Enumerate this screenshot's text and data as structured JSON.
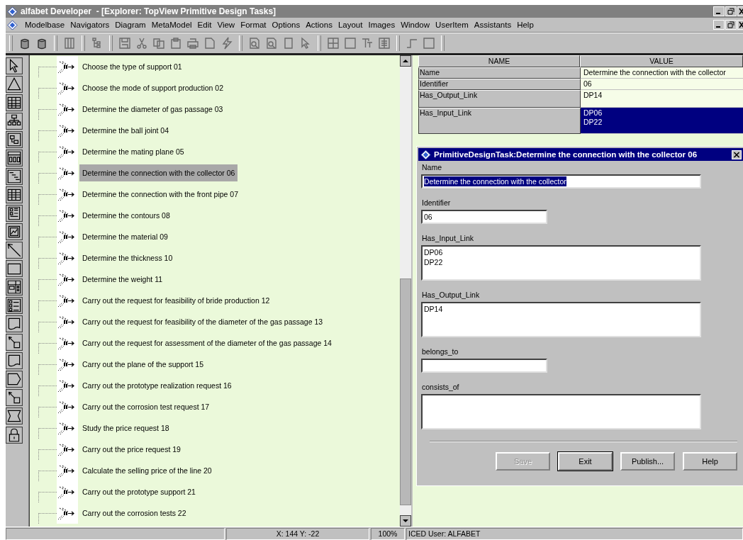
{
  "window": {
    "title": "alfabet Developer  - [Explorer: TopView Primitive Design Tasks]"
  },
  "menu": [
    "Modelbase",
    "Navigators",
    "Diagram",
    "MetaModel",
    "Edit",
    "View",
    "Format",
    "Options",
    "Actions",
    "Layout",
    "Images",
    "Window",
    "UserItem",
    "Assistants",
    "Help"
  ],
  "tree": {
    "items": [
      {
        "label": "Choose the type of support 01",
        "selected": false
      },
      {
        "label": "Choose the mode of support production 02",
        "selected": false
      },
      {
        "label": "Determine the diameter of gas passage 03",
        "selected": false
      },
      {
        "label": "Determine the ball joint 04",
        "selected": false
      },
      {
        "label": "Determine the mating plane 05",
        "selected": false
      },
      {
        "label": "Determine the connection with the collector 06",
        "selected": true
      },
      {
        "label": "Determine the connection with the front pipe 07",
        "selected": false
      },
      {
        "label": "Determine the contours 08",
        "selected": false
      },
      {
        "label": "Determine the material 09",
        "selected": false
      },
      {
        "label": "Determine the thickness 10",
        "selected": false
      },
      {
        "label": "Determine the weight 11",
        "selected": false
      },
      {
        "label": "Carry out the request for feasibility of bride production 12",
        "selected": false
      },
      {
        "label": "Carry out the request for feasibility of the diameter of the gas passage 13",
        "selected": false
      },
      {
        "label": "Carry out the request for assessment of the diameter of the gas passage 14",
        "selected": false
      },
      {
        "label": "Carry out the plane of the support 15",
        "selected": false
      },
      {
        "label": "Carry out the prototype realization request 16",
        "selected": false
      },
      {
        "label": "Carry out the corrosion test request 17",
        "selected": false
      },
      {
        "label": "Study the price request 18",
        "selected": false
      },
      {
        "label": "Carry out the price request 19",
        "selected": false
      },
      {
        "label": "Calculate the selling price of the line 20",
        "selected": false
      },
      {
        "label": "Carry out the prototype support 21",
        "selected": false
      },
      {
        "label": "Carry out the corrosion tests 22",
        "selected": false
      }
    ]
  },
  "properties": {
    "columns": [
      "NAME",
      "VALUE"
    ],
    "rows": [
      {
        "name": "Name",
        "values": [
          "Determine the connection with the collector"
        ],
        "selected": false
      },
      {
        "name": "Identifier",
        "values": [
          "06"
        ],
        "selected": false
      },
      {
        "name": "Has_Output_Link",
        "values": [
          "DP14"
        ],
        "selected": false
      },
      {
        "name": "Has_Input_Link",
        "values": [
          "DP06",
          "DP22"
        ],
        "selected": true
      }
    ]
  },
  "dialog": {
    "title": "PrimitiveDesignTask:Determine the connection with the collector 06",
    "fields": [
      {
        "label": "Name",
        "kind": "text",
        "lines": [
          "Determine the connection with the collector"
        ],
        "highlighted": true
      },
      {
        "label": "Identifier",
        "kind": "short",
        "lines": [
          "06"
        ],
        "highlighted": false
      },
      {
        "label": "Has_Input_Link",
        "kind": "list",
        "lines": [
          "DP06",
          "DP22"
        ],
        "highlighted": false
      },
      {
        "label": "Has_Output_Link",
        "kind": "list",
        "lines": [
          "DP14"
        ],
        "highlighted": false
      },
      {
        "label": "belongs_to",
        "kind": "short"
      },
      {
        "label": "consists_of",
        "kind": "list"
      }
    ],
    "buttons": [
      {
        "label": "Save",
        "disabled": true,
        "default": false
      },
      {
        "label": "Exit",
        "disabled": false,
        "default": true
      },
      {
        "label": "Publish...",
        "disabled": false,
        "default": false
      },
      {
        "label": "Help",
        "disabled": false,
        "default": false
      }
    ]
  },
  "status_bar": {
    "segments": [
      "X: 144 Y: -22",
      "100%",
      "ICED User: ALFABET"
    ]
  }
}
